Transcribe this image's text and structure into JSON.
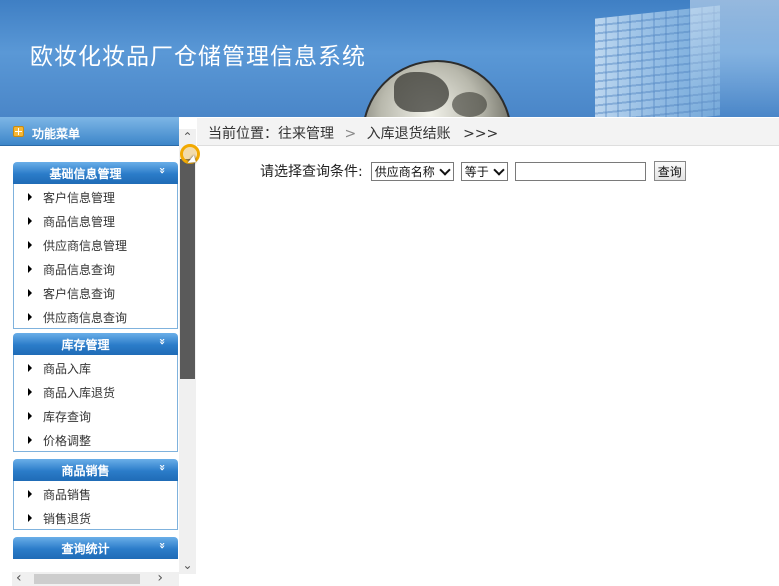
{
  "header": {
    "title": "欧妆化妆品厂仓储管理信息系统"
  },
  "sidebar": {
    "header_label": "功能菜单",
    "groups": [
      {
        "title": "基础信息管理",
        "items": [
          "客户信息管理",
          "商品信息管理",
          "供应商信息管理",
          "商品信息查询",
          "客户信息查询",
          "供应商信息查询"
        ]
      },
      {
        "title": "库存管理",
        "items": [
          "商品入库",
          "商品入库退货",
          "库存查询",
          "价格调整"
        ]
      },
      {
        "title": "商品销售",
        "items": [
          "商品销售",
          "销售退货"
        ]
      },
      {
        "title": "查询统计",
        "items": []
      }
    ],
    "chevron": "»"
  },
  "breadcrumb": {
    "prefix": "当前位置：往来管理",
    "separator": ">",
    "current": "入库退货结账",
    "tail": ">>>"
  },
  "query": {
    "label": "请选择查询条件:",
    "field_select": "供应商名称",
    "operator_select": "等于",
    "value": "",
    "button": "查询"
  },
  "colors": {
    "banner": "#4a86c8",
    "group_header": "#2b7cc9",
    "menu_header": "#5a9ad6"
  }
}
